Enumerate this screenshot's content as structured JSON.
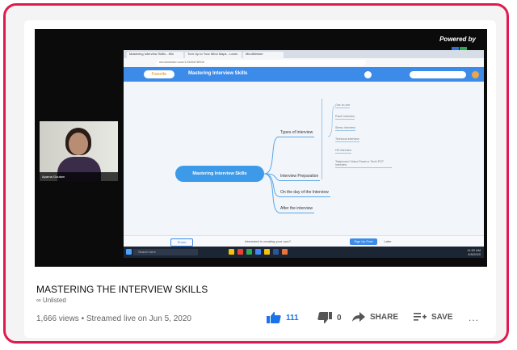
{
  "video": {
    "powered_by": "Powered by",
    "browser": {
      "tabs": [
        "Mastering Interview Skills - Min",
        "Turn Up to Your Mind Maps - Learn",
        "MindMeister"
      ],
      "url": "mindmeister.com/1234567890#",
      "favorite_label": "Favorite",
      "doc_title": "Mastering Interview Skills"
    },
    "mindmap": {
      "central": "Mastering Interview Skills",
      "branches": [
        "Types of Interview",
        "Interview Preparation",
        "On the day of the Interview",
        "After the interview"
      ],
      "leaves": [
        "One on one",
        "Panel Interview",
        "Stress Interview",
        "Technical Interview",
        "HR Interview",
        "Telephonic/ Video/ Panel or Tech/ POT Interview"
      ]
    },
    "bottombar": {
      "share_label": "Share",
      "hint": "Interested in creating your own?",
      "signup_label": "Sign Up Free",
      "later_label": "Later"
    },
    "webcam": {
      "name": "Aparna Goutam"
    },
    "taskbar": {
      "search_placeholder": "Search here",
      "time": "11:52 AM",
      "date": "6/5/2020"
    }
  },
  "title": "MASTERING THE INTERVIEW SKILLS",
  "visibility": "∞ Unlisted",
  "meta": "1,666 views • Streamed live on Jun 5, 2020",
  "actions": {
    "likes": "111",
    "dislikes": "0",
    "share": "SHARE",
    "save": "SAVE",
    "more": "..."
  },
  "colors": {
    "frame": "#e0194f",
    "like": "#1a73e8",
    "app_toolbar": "#3d8be8"
  }
}
